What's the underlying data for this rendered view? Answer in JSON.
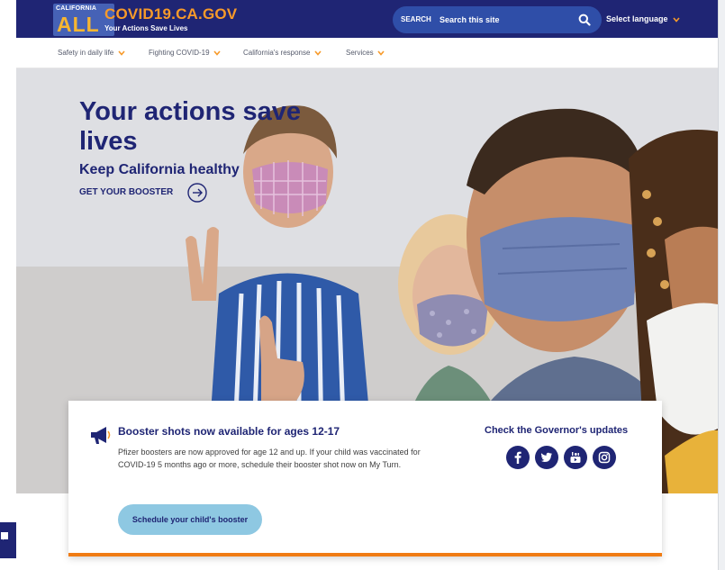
{
  "header": {
    "logo_small": "CALIFORNIA",
    "logo_large": "ALL",
    "site_title": "COVID19.CA.GOV",
    "tagline": "Your Actions Save Lives",
    "search_label": "SEARCH",
    "search_placeholder": "Search this site",
    "language_label": "Select language"
  },
  "nav": {
    "items": [
      {
        "label": "Safety in daily life"
      },
      {
        "label": "Fighting COVID-19"
      },
      {
        "label": "California's response"
      },
      {
        "label": "Services"
      }
    ]
  },
  "hero": {
    "title": "Your actions save lives",
    "subtitle": "Keep California healthy",
    "cta": "GET YOUR BOOSTER"
  },
  "card": {
    "title": "Booster shots now available for ages 12-17",
    "body": "Pfizer boosters are now approved for age 12 and up. If your child was vaccinated for COVID-19 5 months ago or more, schedule their booster shot now on My Turn.",
    "button": "Schedule your child's booster",
    "governor_title": "Check the Governor's updates",
    "social": [
      "facebook-icon",
      "twitter-icon",
      "youtube-icon",
      "instagram-icon"
    ]
  },
  "colors": {
    "navy": "#1f2574",
    "orange": "#f79a2a",
    "search_blue": "#2f4ea8",
    "button_blue": "#8ec8e2"
  }
}
